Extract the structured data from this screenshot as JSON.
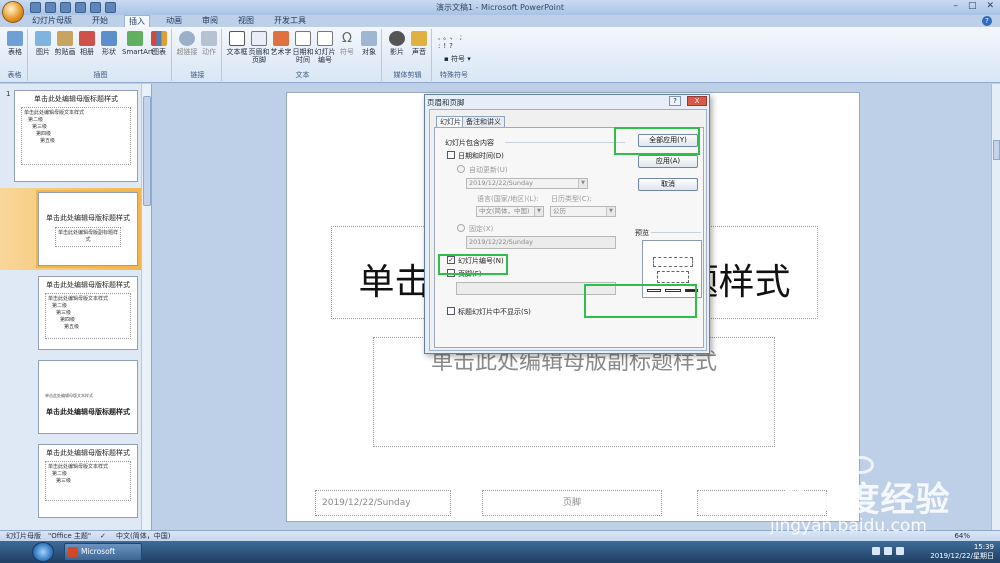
{
  "app": {
    "title": "演示文稿1 - Microsoft PowerPoint",
    "window_controls": [
      "–",
      "□",
      "✕"
    ]
  },
  "ribbon": {
    "tabs": [
      "幻灯片母版",
      "开始",
      "插入",
      "动画",
      "审阅",
      "视图",
      "开发工具"
    ],
    "active_tab": "插入",
    "groups": [
      {
        "label": "表格",
        "buttons": [
          "表格"
        ]
      },
      {
        "label": "插图",
        "buttons": [
          "图片",
          "剪贴画",
          "相册",
          "形状",
          "SmartArt",
          "图表"
        ]
      },
      {
        "label": "链接",
        "buttons": [
          "超链接",
          "动作"
        ]
      },
      {
        "label": "文本",
        "buttons": [
          "文本框",
          "页眉和页脚",
          "艺术字",
          "日期和时间",
          "幻灯片编号",
          "符号",
          "对象"
        ]
      },
      {
        "label": "媒体剪辑",
        "buttons": [
          "影片",
          "声音"
        ]
      },
      {
        "label": "特殊符号",
        "buttons": [
          "符号"
        ]
      }
    ],
    "special_symbols": [
      ",",
      "。",
      "、",
      ";",
      ":",
      "!",
      "?"
    ]
  },
  "slides_panel": {
    "slide_number": "1",
    "thumbs": [
      {
        "title": "单击此处编辑母版标题样式",
        "body": [
          "单击此处编辑母版文本样式",
          "第二级",
          "第三级",
          "第四级",
          "第五级"
        ]
      },
      {
        "title": "单击此处编辑母版标题样式",
        "body": [
          "单击此处编辑母版副标题样式"
        ]
      },
      {
        "title": "单击此处编辑母版标题样式",
        "body": [
          "单击此处编辑母版文本样式",
          "第二级",
          "第三级",
          "第四级",
          "第五级"
        ]
      },
      {
        "title": "单击此处编辑母版标题样式",
        "body": [
          "单击此处编辑母版文本样式"
        ]
      },
      {
        "title": "单击此处编辑母版标题样式",
        "body": [
          "单击此处编辑母版文本样式",
          "第二级",
          "第三级"
        ]
      }
    ]
  },
  "slide": {
    "title_placeholder": "单击此处编辑母版标题样式",
    "subtitle_placeholder": "单击此处编辑母版副标题样式",
    "date": "2019/12/22/Sunday",
    "footer": "页脚"
  },
  "dialog": {
    "title": "页眉和页脚",
    "help_btn": "?",
    "close_btn": "X",
    "tabs": [
      "幻灯片",
      "备注和讲义"
    ],
    "section_label": "幻灯片包含内容",
    "date_time_label": "日期和时间(D)",
    "auto_update_label": "自动更新(U)",
    "auto_update_value": "2019/12/22/Sunday",
    "language_label": "语言(国家/地区)(L):",
    "language_value": "中文(简体，中国)",
    "calendar_label": "日历类型(C):",
    "calendar_value": "公历",
    "fixed_label": "固定(X)",
    "fixed_value": "2019/12/22/Sunday",
    "slide_number_label": "幻灯片编号(N)",
    "slide_number_checked": true,
    "footer_label": "页脚(F)",
    "hide_on_title_label": "标题幻灯片中不显示(S)",
    "apply_all_btn": "全部应用(Y)",
    "apply_btn": "应用(A)",
    "cancel_btn": "取消",
    "preview_label": "预览"
  },
  "statusbar": {
    "view": "幻灯片母版",
    "theme": "\"Office 主题\"",
    "language": "中文(简体，中国)",
    "zoom": "64%"
  },
  "taskbar": {
    "app_button": "Microsoft Powe...",
    "time": "15:39",
    "date": "2019/12/22/星期日"
  },
  "watermark": {
    "brand": "Bai度经验",
    "url": "jingyan.baidu.com"
  },
  "colors": {
    "highlight": "#2dbf4a",
    "ribbon_bg": "#dae6f5",
    "selected_thumb": "#f3b650"
  }
}
